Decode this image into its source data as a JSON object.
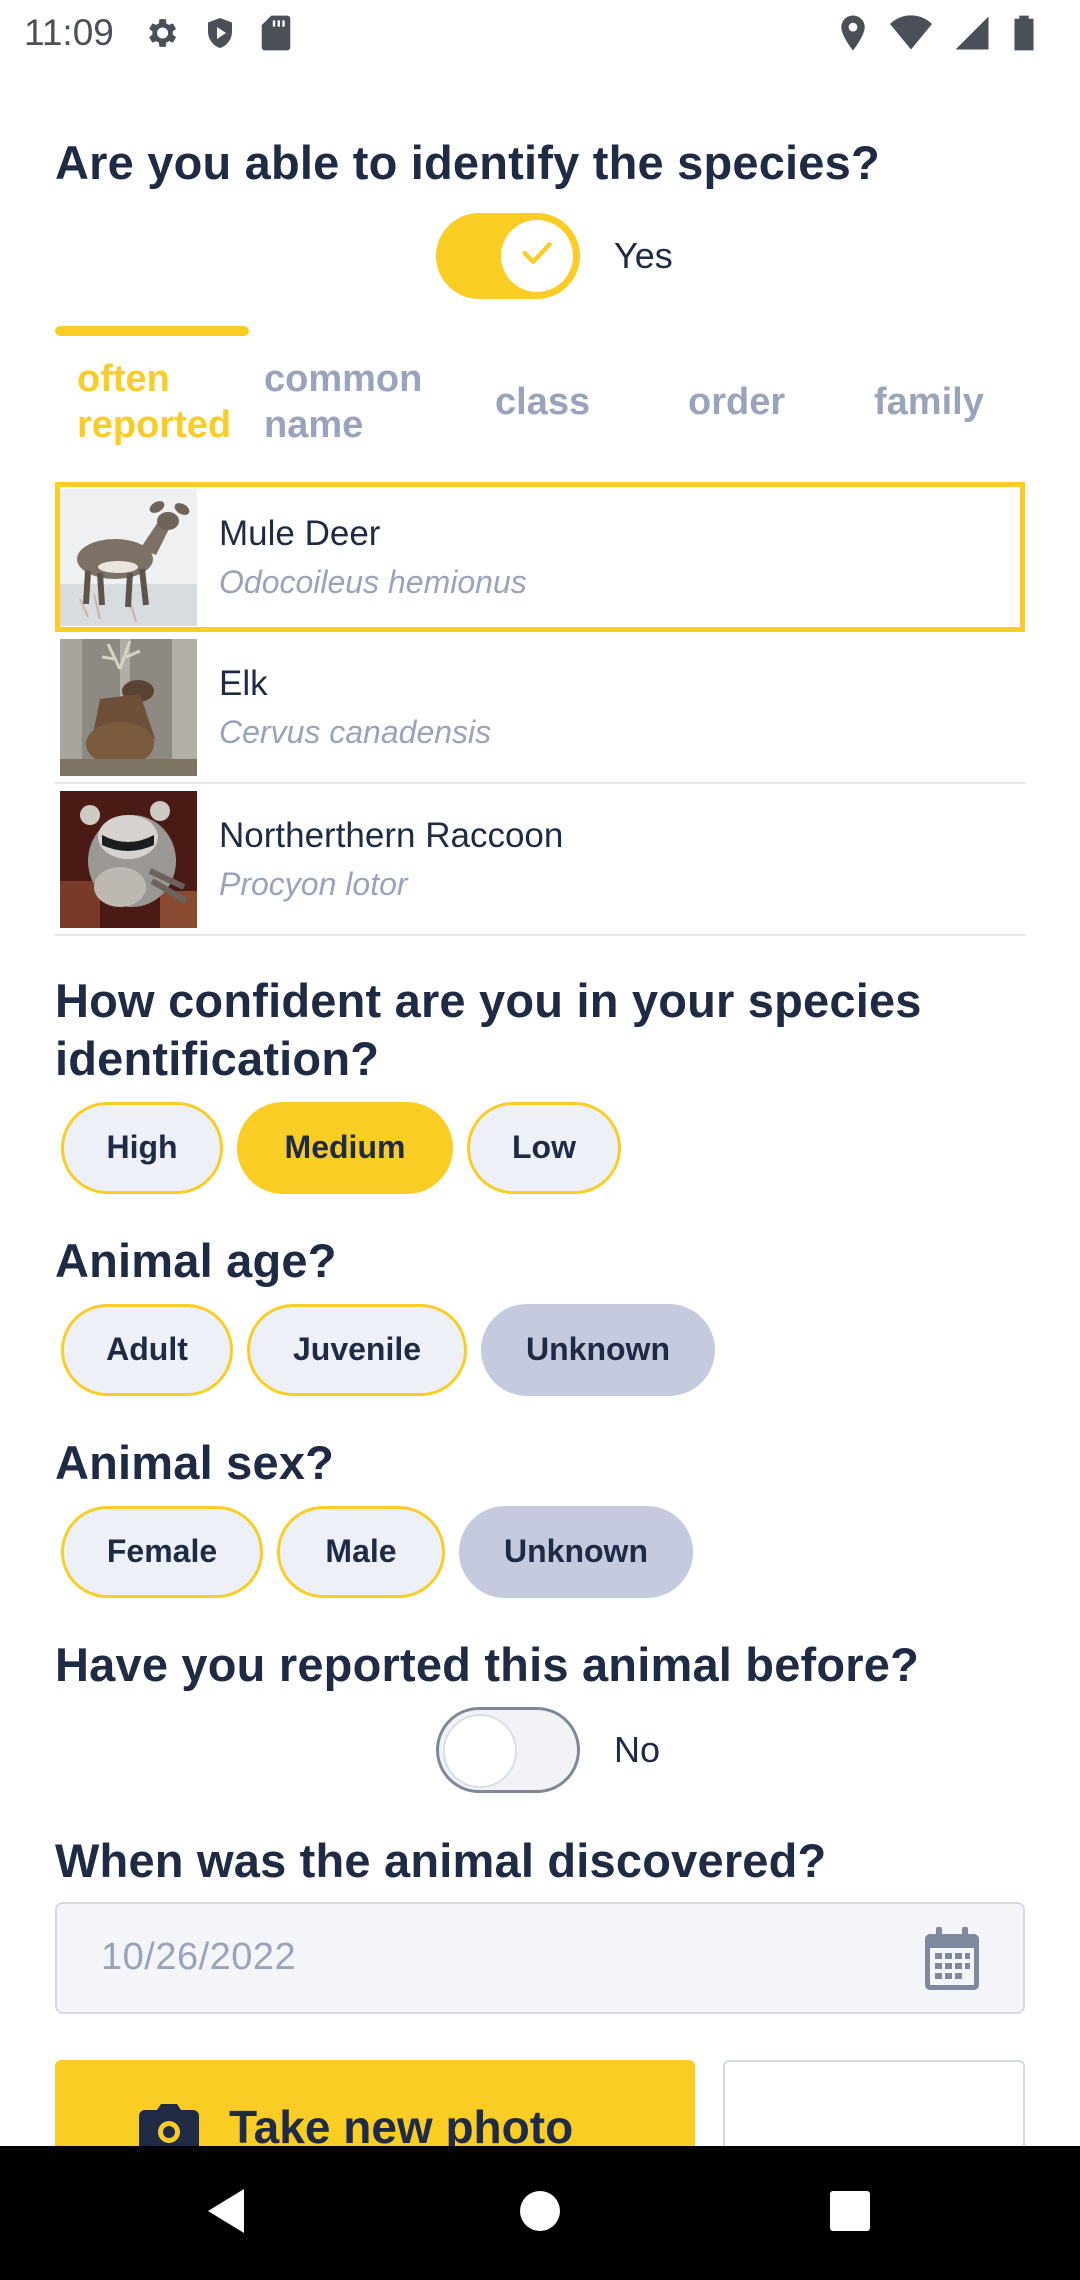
{
  "status_bar": {
    "time": "11:09",
    "icons_left": [
      "settings-icon",
      "shield-icon",
      "sd-card-icon"
    ],
    "icons_right": [
      "location-icon",
      "wifi-icon",
      "signal-icon",
      "battery-icon"
    ]
  },
  "identify": {
    "question": "Are you able to identify the species?",
    "toggle_on": true,
    "toggle_label": "Yes"
  },
  "tabs": [
    {
      "line1": "often",
      "line2": "reported",
      "active": true
    },
    {
      "line1": "common",
      "line2": "name",
      "active": false
    },
    {
      "line1": "class",
      "line2": "",
      "active": false
    },
    {
      "line1": "order",
      "line2": "",
      "active": false
    },
    {
      "line1": "family",
      "line2": "",
      "active": false
    }
  ],
  "species": [
    {
      "name": "Mule Deer",
      "scientific": "Odocoileus hemionus",
      "selected": true
    },
    {
      "name": "Elk",
      "scientific": "Cervus canadensis",
      "selected": false
    },
    {
      "name": "Northerthern Raccoon",
      "scientific": "Procyon lotor",
      "selected": false
    }
  ],
  "confidence": {
    "question": "How confident are you in your species identification?",
    "options": [
      "High",
      "Medium",
      "Low"
    ],
    "selected": "Medium"
  },
  "age": {
    "question": "Animal age?",
    "options": [
      "Adult",
      "Juvenile",
      "Unknown"
    ],
    "selected": "Unknown"
  },
  "sex": {
    "question": "Animal sex?",
    "options": [
      "Female",
      "Male",
      "Unknown"
    ],
    "selected": "Unknown"
  },
  "reported_before": {
    "question": "Have you reported this animal before?",
    "toggle_on": false,
    "toggle_label": "No"
  },
  "discovered": {
    "question": "When was the animal discovered?",
    "date": "10/26/2022"
  },
  "photo": {
    "take_label": "Take new photo"
  },
  "colors": {
    "accent": "#f9cd24",
    "text": "#1f2a44",
    "muted": "#9aa3bc",
    "chip_bg": "#eef0f8",
    "chip_grey": "#c5cadf"
  }
}
